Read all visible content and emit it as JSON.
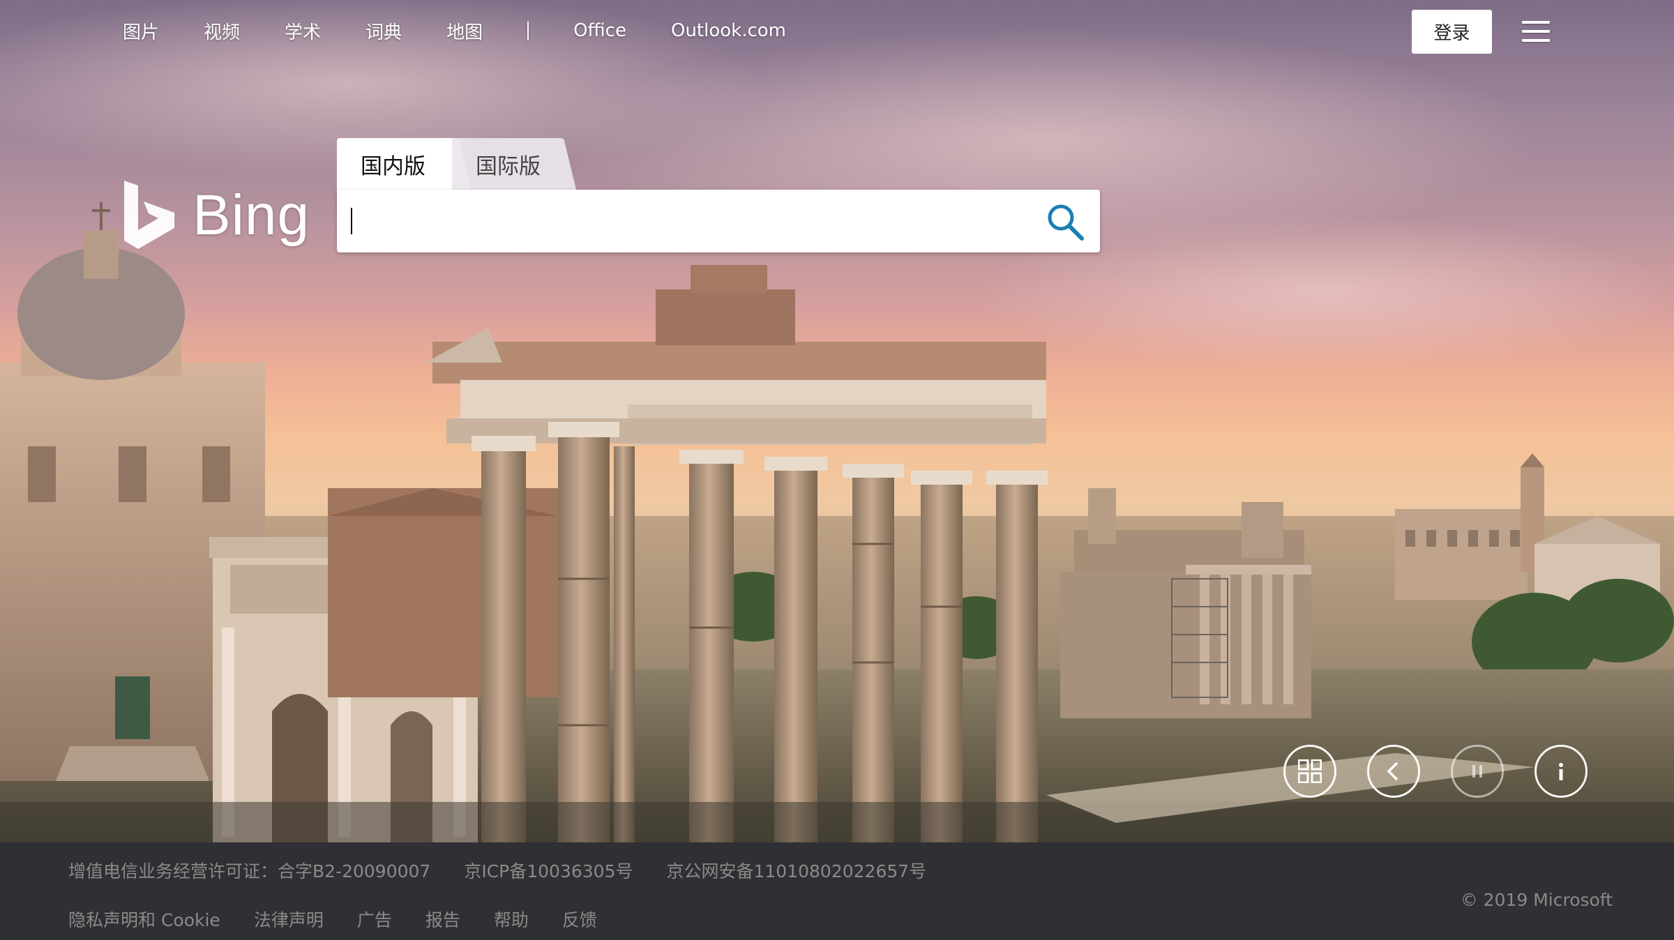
{
  "topnav": {
    "links": [
      "图片",
      "视频",
      "学术",
      "词典",
      "地图"
    ],
    "separator": "|",
    "links_right": [
      "Office",
      "Outlook.com"
    ]
  },
  "header": {
    "login_label": "登录",
    "menu_icon": "hamburger-menu-icon"
  },
  "logo": {
    "text": "Bing",
    "icon": "bing-logo-icon"
  },
  "search": {
    "tabs": [
      {
        "label": "国内版",
        "active": true
      },
      {
        "label": "国际版",
        "active": false
      }
    ],
    "value": "",
    "placeholder": "",
    "icon": "search-icon"
  },
  "carousel": {
    "controls": [
      "grid-icon",
      "chevron-left-icon",
      "pause-icon",
      "info-icon"
    ]
  },
  "footer": {
    "licenses": [
      "增值电信业务经营许可证：合字B2-20090007",
      "京ICP备10036305号",
      "京公网安备11010802022657号"
    ],
    "links": [
      "隐私声明和 Cookie",
      "法律声明",
      "广告",
      "报告",
      "帮助",
      "反馈"
    ],
    "copyright": "© 2019 Microsoft"
  },
  "colors": {
    "accent": "#1a7eb3",
    "footer_bg": "#2f3033",
    "footer_text": "#8a8a8a"
  }
}
